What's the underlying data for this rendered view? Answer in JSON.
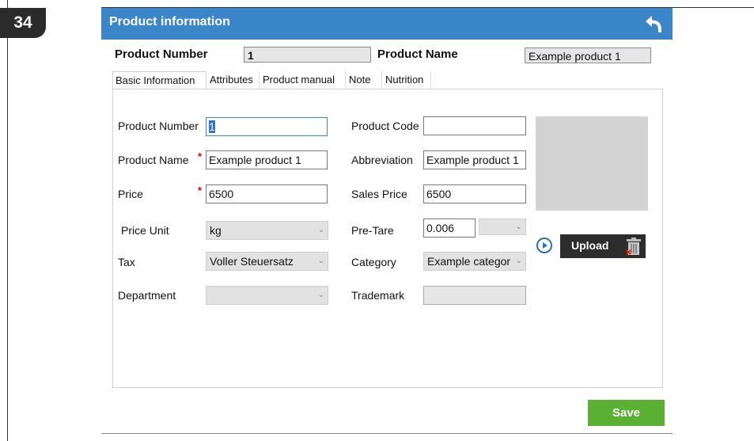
{
  "page_number": "34",
  "window": {
    "title": "Product information"
  },
  "header": {
    "product_number_label": "Product Number",
    "product_number_value": "1",
    "product_name_label": "Product Name",
    "product_name_value": "Example product 1"
  },
  "tabs": [
    {
      "label": "Basic Information",
      "active": true
    },
    {
      "label": "Attributes",
      "active": false
    },
    {
      "label": "Product manual",
      "active": false
    },
    {
      "label": "Note",
      "active": false
    },
    {
      "label": "Nutrition",
      "active": false
    }
  ],
  "form": {
    "product_number": {
      "label": "Product Number",
      "value": "1"
    },
    "product_name": {
      "label": "Product Name",
      "value": "Example product 1",
      "required_mark": "*"
    },
    "price": {
      "label": "Price",
      "value": "6500",
      "required_mark": "*"
    },
    "price_unit": {
      "label": "Price Unit",
      "value": "kg"
    },
    "tax": {
      "label": "Tax",
      "value": "Voller Steuersatz"
    },
    "department": {
      "label": "Department",
      "value": ""
    },
    "product_code": {
      "label": "Product Code",
      "value": ""
    },
    "abbreviation": {
      "label": "Abbreviation",
      "value": "Example product 1"
    },
    "sales_price": {
      "label": "Sales Price",
      "value": "6500"
    },
    "pre_tare": {
      "label": "Pre-Tare",
      "value": "0.006",
      "unit_value": ""
    },
    "category": {
      "label": "Category",
      "value": "Example categor"
    },
    "trademark": {
      "label": "Trademark",
      "value": ""
    }
  },
  "upload_button": {
    "label": "Upload"
  },
  "save_button": {
    "label": "Save"
  },
  "colors": {
    "titlebar": "#3b86c8",
    "save": "#5ab033",
    "upload": "#2d2d2d",
    "required": "#e00000"
  }
}
